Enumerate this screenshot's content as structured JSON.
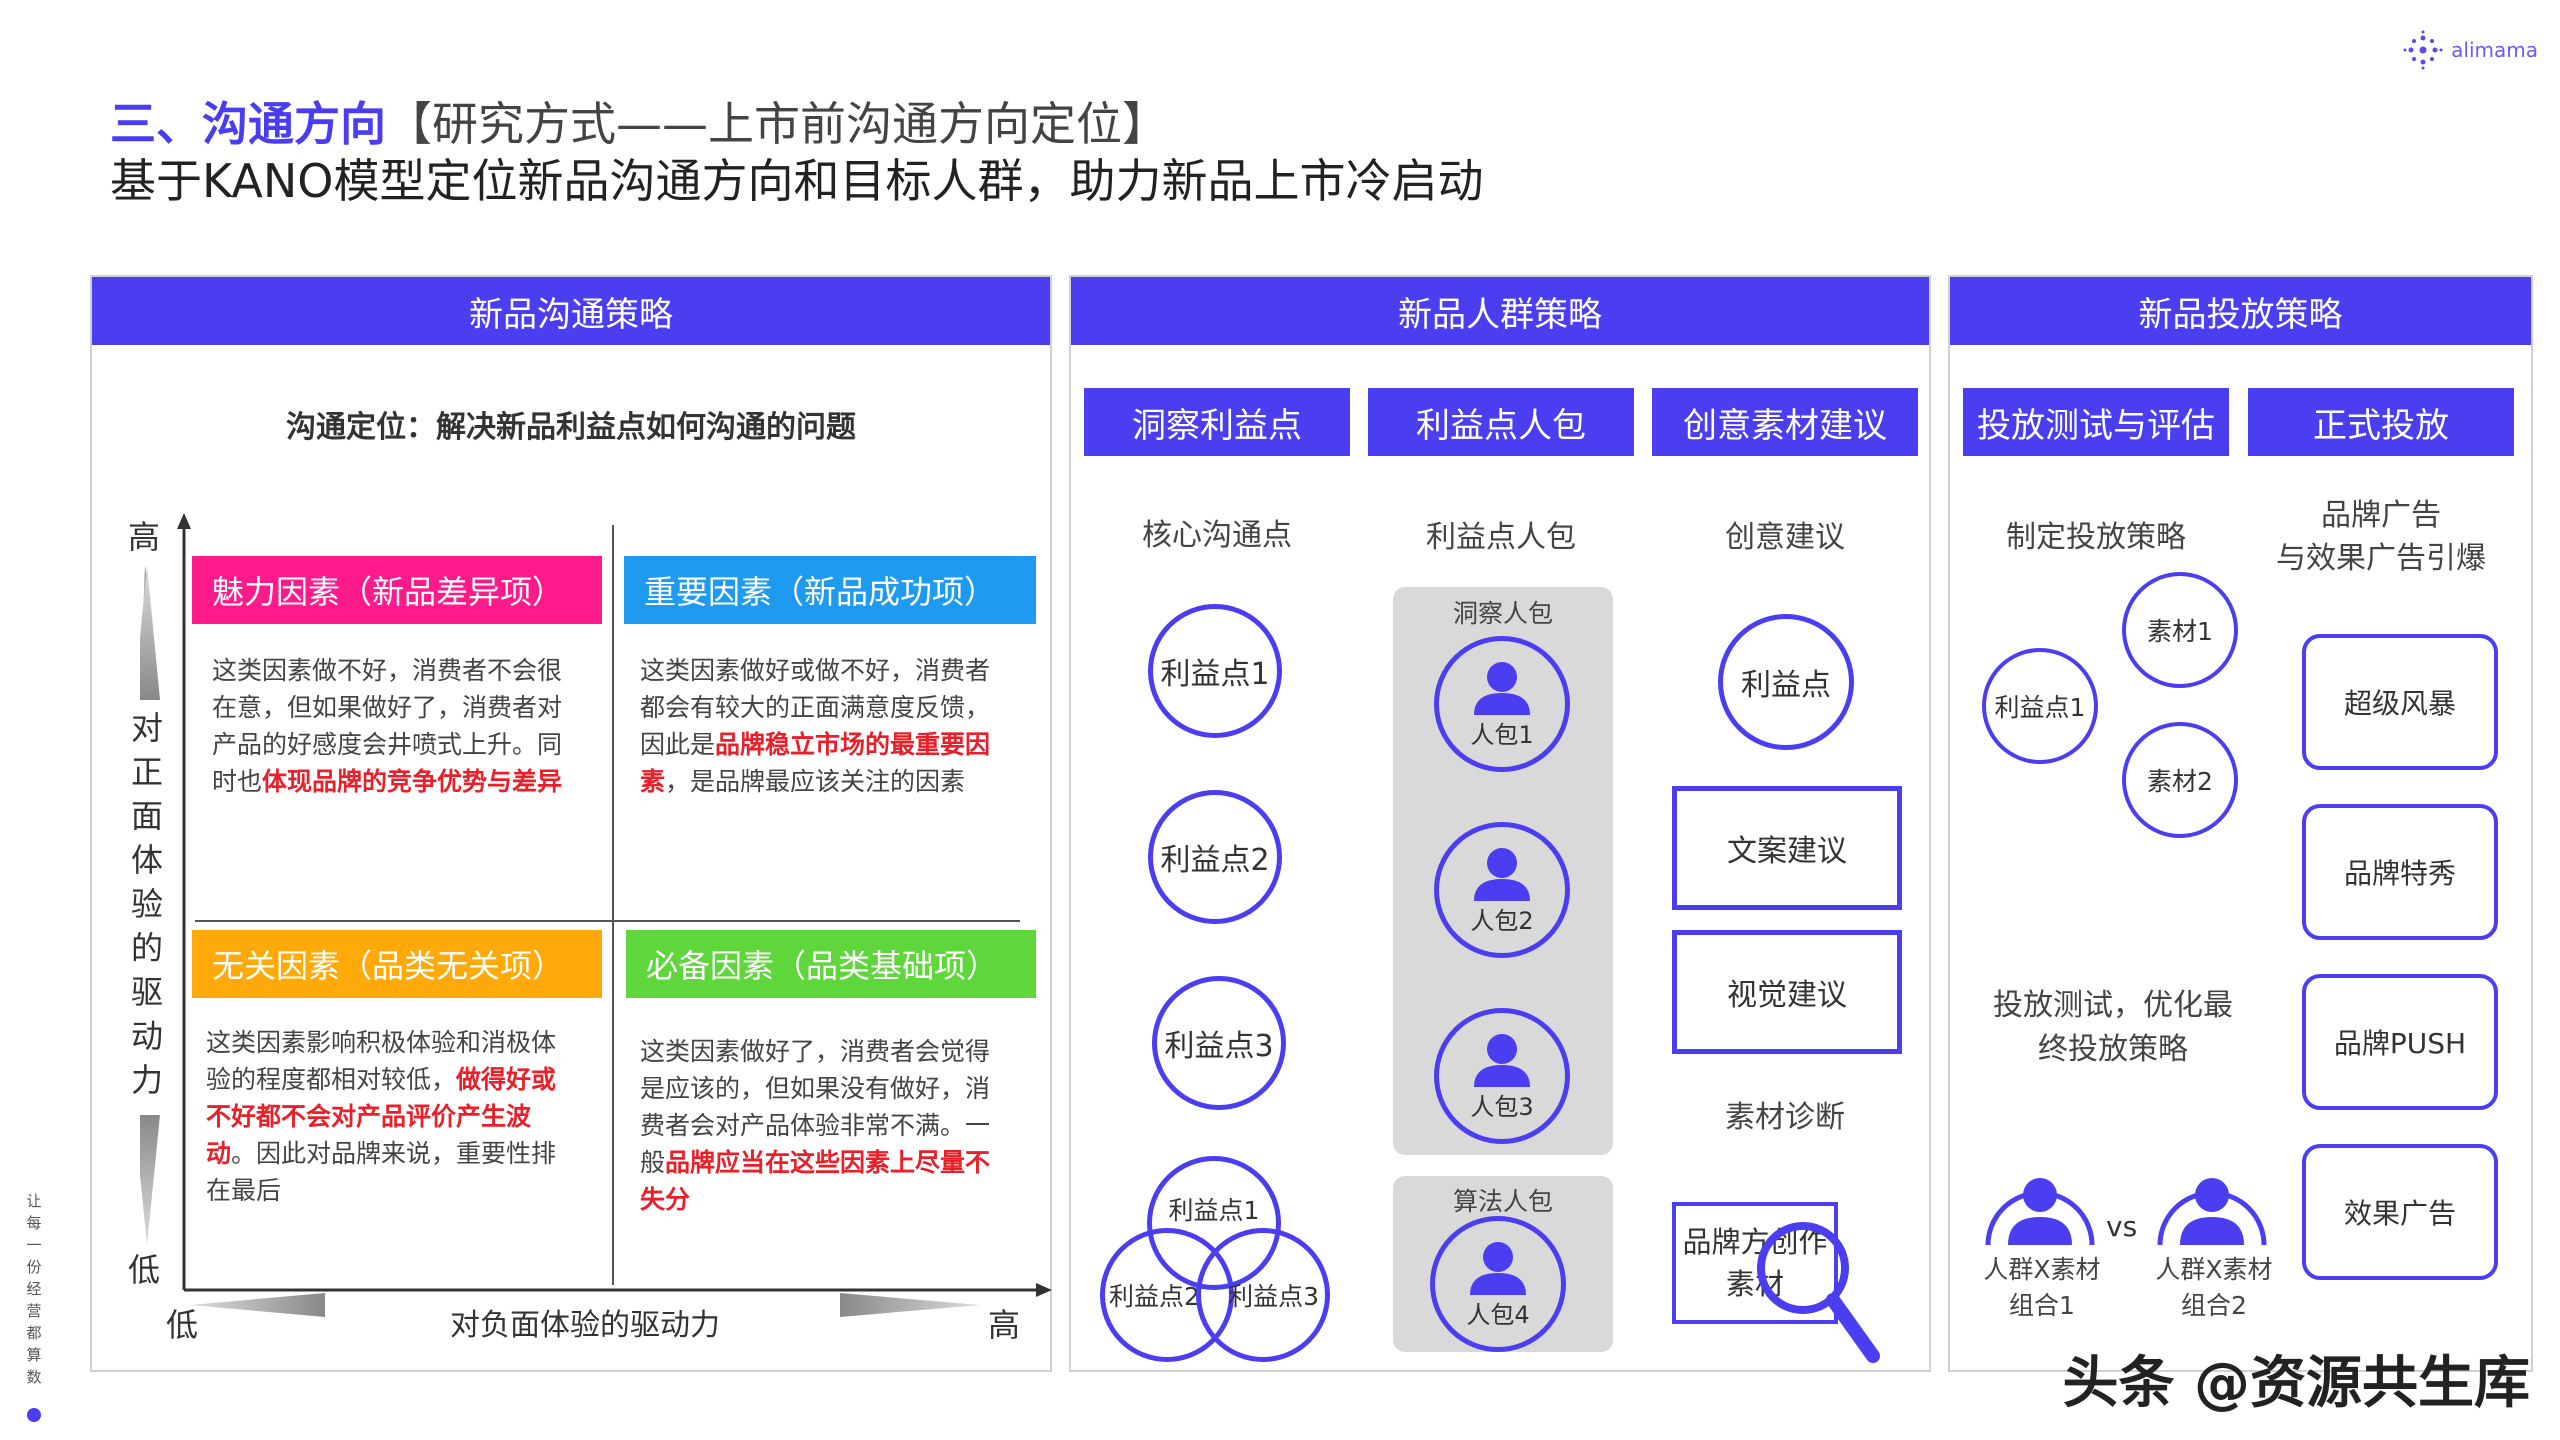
{
  "header": {
    "title_prefix": "三、沟通方向",
    "title_suffix": "【研究方式——上市前沟通方向定位】",
    "subtitle": "基于KANO模型定位新品沟通方向和目标人群，助力新品上市冷启动",
    "logo_text": "alimama"
  },
  "panel1": {
    "head": "新品沟通策略",
    "positioning": "沟通定位：解决新品利益点如何沟通的问题",
    "y_high": "高",
    "y_low": "低",
    "y_label_chars": [
      "对",
      "正",
      "面",
      "体",
      "验",
      "的",
      "驱",
      "动",
      "力"
    ],
    "x_low": "低",
    "x_high": "高",
    "x_label": "对负面体验的驱动力",
    "q1": {
      "head": "魅力因素（新品差异项）",
      "text_a": "这类因素做不好，消费者不会很在意，但如果做好了，消费者对产品的好感度会井喷式上升。同时也",
      "text_b": "体现品牌的竞争优势与差异",
      "color": "#ff1a8c"
    },
    "q2": {
      "head": "重要因素（新品成功项）",
      "text_a": "这类因素做好或做不好，消费者都会有较大的正面满意度反馈，因此是",
      "text_b": "品牌稳立市场的最重要因素",
      "text_c": "，是品牌最应该关注的因素",
      "color": "#1e9bf0"
    },
    "q3": {
      "head": "无关因素（品类无关项）",
      "text_a": "这类因素影响积极体验和消极体验的程度都相对较低，",
      "text_b": "做得好或不好都不会对产品评价产生波动",
      "text_c": "。因此对品牌来说，重要性排在最后",
      "color": "#ffa90a"
    },
    "q4": {
      "head": "必备因素（品类基础项）",
      "text_a": "这类因素做好了，消费者会觉得是应该的，但如果没有做好，消费者会对产品体验非常不满。一般",
      "text_b": "品牌应当在这些因素上尽量不失分",
      "color": "#5fd63b"
    }
  },
  "panel2": {
    "head": "新品人群策略",
    "sub1": "洞察利益点",
    "sub2": "利益点人包",
    "sub3": "创意素材建议",
    "col1_label": "核心沟通点",
    "col2_label": "利益点人包",
    "col3_label": "创意建议",
    "benefits": [
      "利益点1",
      "利益点2",
      "利益点3"
    ],
    "venn": [
      "利益点1",
      "利益点2",
      "利益点3"
    ],
    "insight_pack": "洞察人包",
    "packs": [
      "人包1",
      "人包2",
      "人包3"
    ],
    "algo_pack": "算法人包",
    "algo_person": "人包4",
    "creative_circle": "利益点",
    "copy_advice": "文案建议",
    "visual_advice": "视觉建议",
    "material_diag": "素材诊断",
    "brand_creative": "品牌方创作素材"
  },
  "panel3": {
    "head": "新品投放策略",
    "sub1": "投放测试与评估",
    "sub2": "正式投放",
    "make_strategy": "制定投放策略",
    "brand_ads_1": "品牌广告",
    "brand_ads_2": "与效果广告引爆",
    "benefit": "利益点1",
    "mat1": "素材1",
    "mat2": "素材2",
    "test_1": "投放测试，优化最",
    "test_2": "终投放策略",
    "boxes": [
      "超级风暴",
      "品牌特秀",
      "品牌PUSH",
      "效果广告"
    ],
    "vs": "vs",
    "group1_a": "人群X素材",
    "group1_b": "组合1",
    "group2_a": "人群X素材",
    "group2_b": "组合2"
  },
  "side_text": "让每一份经营都算数",
  "watermark": "头条 @资源共生库"
}
